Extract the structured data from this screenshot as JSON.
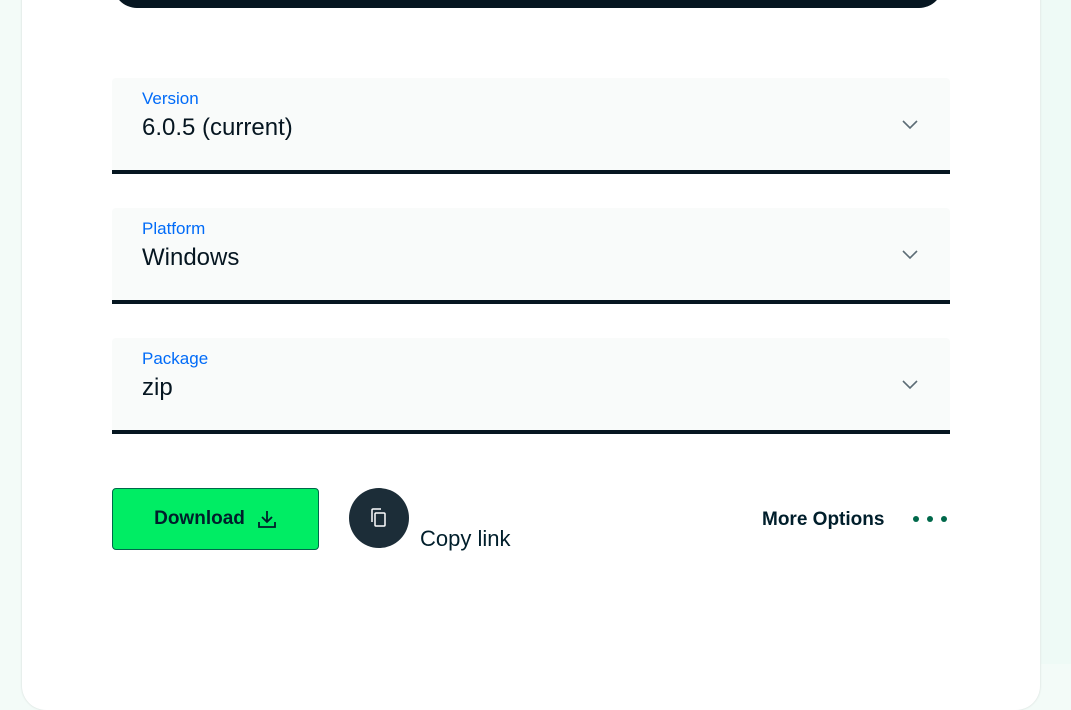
{
  "form": {
    "version": {
      "label": "Version",
      "value": "6.0.5 (current)"
    },
    "platform": {
      "label": "Platform",
      "value": "Windows"
    },
    "package": {
      "label": "Package",
      "value": "zip"
    }
  },
  "actions": {
    "download_label": "Download",
    "copy_link_label": "Copy link",
    "more_options_label": "More Options"
  },
  "colors": {
    "accent_label": "#016bf8",
    "download_bg": "#00ed64",
    "dark": "#061621",
    "dots": "#00684a"
  },
  "icons": [
    "chevron-down-icon",
    "download-icon",
    "copy-icon",
    "ellipsis-icon"
  ]
}
